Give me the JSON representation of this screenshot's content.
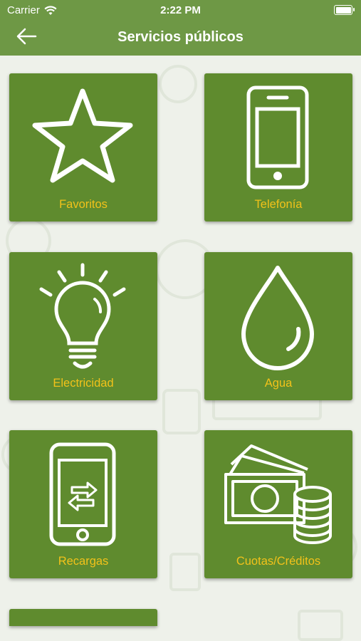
{
  "status": {
    "carrier": "Carrier",
    "time": "2:22 PM"
  },
  "nav": {
    "title": "Servicios públicos"
  },
  "tiles": [
    {
      "label": "Favoritos",
      "icon": "star-icon"
    },
    {
      "label": "Telefonía",
      "icon": "mobile-phone-icon"
    },
    {
      "label": "Electricidad",
      "icon": "light-bulb-icon"
    },
    {
      "label": "Agua",
      "icon": "water-drop-icon"
    },
    {
      "label": "Recargas",
      "icon": "phone-transfer-icon"
    },
    {
      "label": "Cuotas/Créditos",
      "icon": "money-coins-icon"
    }
  ],
  "colors": {
    "header": "#6e9845",
    "tile": "#5f8b2e",
    "label": "#f2c21a"
  }
}
